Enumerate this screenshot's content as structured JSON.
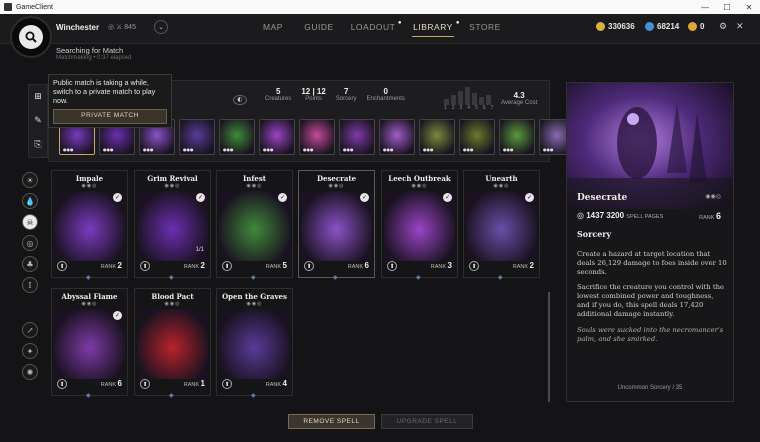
{
  "window": {
    "title": "GameClient",
    "min": "—",
    "max": "☐",
    "close": "✕"
  },
  "player": {
    "name": "Winchester",
    "level": "845"
  },
  "nav": {
    "items": [
      "MAP",
      "GUIDE",
      "LOADOUT",
      "LIBRARY",
      "STORE"
    ],
    "active": "LIBRARY"
  },
  "currencies": [
    {
      "value": "330636",
      "color": "#d9b341"
    },
    {
      "value": "68214",
      "color": "#4a8fd6"
    },
    {
      "value": "0",
      "color": "#e0a63a"
    }
  ],
  "search": {
    "status": "Searching for Match",
    "sub": "Matchmaking • 0:37 elapsed"
  },
  "tooltip": {
    "text": "Public match is taking a while, switch to a private match to play now.",
    "button": "PRIVATE MATCH"
  },
  "deck_stats": {
    "creatures": {
      "value": "5",
      "label": "Creatures"
    },
    "points": {
      "value": "12 | 12",
      "label": "Points"
    },
    "sorcery": {
      "value": "7",
      "label": "Sorcery"
    },
    "enchantments": {
      "value": "0",
      "label": "Enchantments"
    },
    "histogram_labels": "1 2 3 4 5 6 7",
    "avg_cost": {
      "value": "4.3",
      "label": "Average Cost"
    }
  },
  "cards": [
    {
      "name": "Impale",
      "rank": "2",
      "checked": true,
      "color": "#7a3bc0"
    },
    {
      "name": "Grim Revival",
      "rank": "2",
      "checked": true,
      "count": "1/1",
      "color": "#6b2fb0"
    },
    {
      "name": "Infest",
      "rank": "5",
      "checked": true,
      "color": "#3f8a3a"
    },
    {
      "name": "Desecrate",
      "rank": "6",
      "checked": true,
      "color": "#8a52c8"
    },
    {
      "name": "Leech Outbreak",
      "rank": "3",
      "checked": true,
      "color": "#9a44c6"
    },
    {
      "name": "Unearth",
      "rank": "2",
      "checked": true,
      "color": "#6a4ea8"
    },
    {
      "name": "Abyssal Flame",
      "rank": "6",
      "checked": true,
      "color": "#7f3aa8"
    },
    {
      "name": "Blood Pact",
      "rank": "1",
      "checked": false,
      "color": "#b8232a"
    },
    {
      "name": "Open the Graves",
      "rank": "4",
      "checked": false,
      "color": "#5a3b9a"
    }
  ],
  "detail": {
    "name": "Desecrate",
    "stat_value": "1437",
    "spell_pages": "3200",
    "spell_pages_label": "SPELL PAGES",
    "rank_label": "RANK",
    "rank": "6",
    "type": "Sorcery",
    "desc1": "Create a hazard at target location that deals 26,129 damage to foes inside over 10 seconds.",
    "desc2": "Sacrifice the creature you control with the lowest combined power and toughness, and if you do, this spell deals 17,420 additional damage instantly.",
    "flavor": "Souls were sucked into the necromancer's palm, and she smirked.",
    "rarity": "Uncommon Sorcery / 35"
  },
  "buttons": {
    "remove": "REMOVE SPELL",
    "upgrade": "UPGRADE SPELL"
  },
  "rank_label": "RANK"
}
